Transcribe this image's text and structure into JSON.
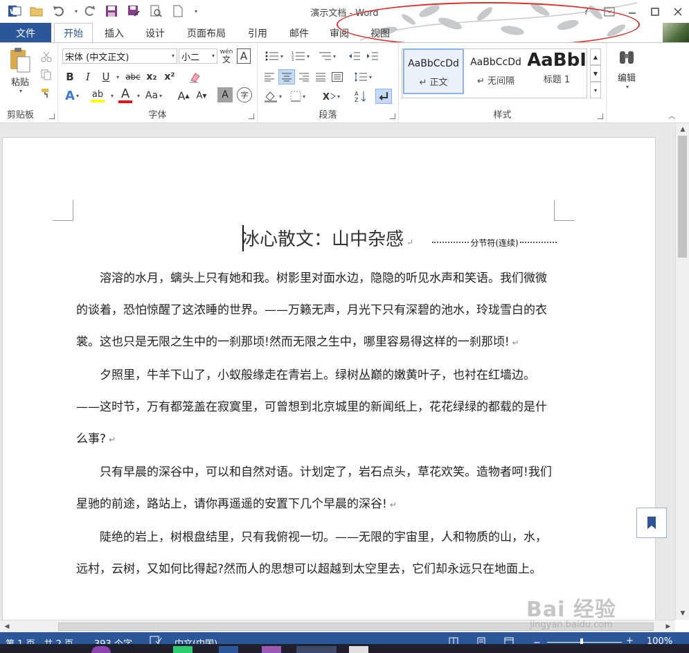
{
  "app": {
    "title": "演示文档 - Word",
    "help": "?",
    "colors": {
      "brand": "#2b579a",
      "highlight_ellipse": "#d9302c"
    }
  },
  "tabs": [
    {
      "label": "文件"
    },
    {
      "label": "开始"
    },
    {
      "label": "插入"
    },
    {
      "label": "设计"
    },
    {
      "label": "页面布局"
    },
    {
      "label": "引用"
    },
    {
      "label": "邮件"
    },
    {
      "label": "审阅"
    },
    {
      "label": "视图"
    }
  ],
  "ribbon": {
    "clipboard": {
      "label": "剪贴板",
      "paste_label": "粘贴"
    },
    "font": {
      "label": "字体",
      "font_name": "宋体 (中文正文)",
      "font_size": "小二",
      "phonetic_top": "wén",
      "phonetic_bottom": "文",
      "char_border": "A",
      "bold": "B",
      "italic": "I",
      "underline": "U",
      "strike": "abc",
      "subscript": "x₂",
      "superscript": "x²",
      "text_effect": "A",
      "highlight": "ab",
      "font_color": "A",
      "change_case": "Aa",
      "grow": "A",
      "shrink": "A",
      "char_shading": "A",
      "enclose": "字"
    },
    "paragraph": {
      "label": "段落"
    },
    "styles": {
      "label": "样式",
      "items": [
        {
          "sample": "AaBbCcDd",
          "name": "↵ 正文"
        },
        {
          "sample": "AaBbCcDd",
          "name": "↵ 无间隔"
        },
        {
          "sample": "AaBbI",
          "name": "标题 1"
        }
      ]
    },
    "editing": {
      "label": "编辑"
    }
  },
  "document": {
    "heading": "冰心散文：山中杂感",
    "section_break": "分节符(连续)",
    "paragraphs": [
      "溶溶的水月，螭头上只有她和我。树影里对面水边，隐隐的听见水声和笑语。我们微微的谈着，恐怕惊醒了这浓睡的世界。——万籁无声，月光下只有深碧的池水，玲珑雪白的衣裳。这也只是无限之生中的一刹那顷!然而无限之生中，哪里容易得这样的一刹那顷!",
      "夕照里，牛羊下山了，小蚁般缘走在青岩上。绿树丛巅的嫩黄叶子，也衬在红墙边。——这时节，万有都笼盖在寂寞里，可曾想到北京城里的新闻纸上，花花绿绿的都载的是什么事?",
      "只有早晨的深谷中，可以和自然对语。计划定了，岩石点头，草花欢笑。造物者呵!我们星驰的前途，路站上，请你再遥遥的安置下几个早晨的深谷!",
      "陡绝的岩上，树根盘结里，只有我俯视一切。——无限的宇宙里，人和物质的山，水，远村，云树，又如何比得起?然而人的思想可以超越到太空里去，它们却永远只在地面上。"
    ]
  },
  "statusbar": {
    "page": "第 1 页，共 2 页",
    "words": "393 个字",
    "language": "中文(中国)",
    "zoom": "100%"
  },
  "watermark": {
    "main": "Bai 经验",
    "sub": "jingyan.baidu.com"
  }
}
